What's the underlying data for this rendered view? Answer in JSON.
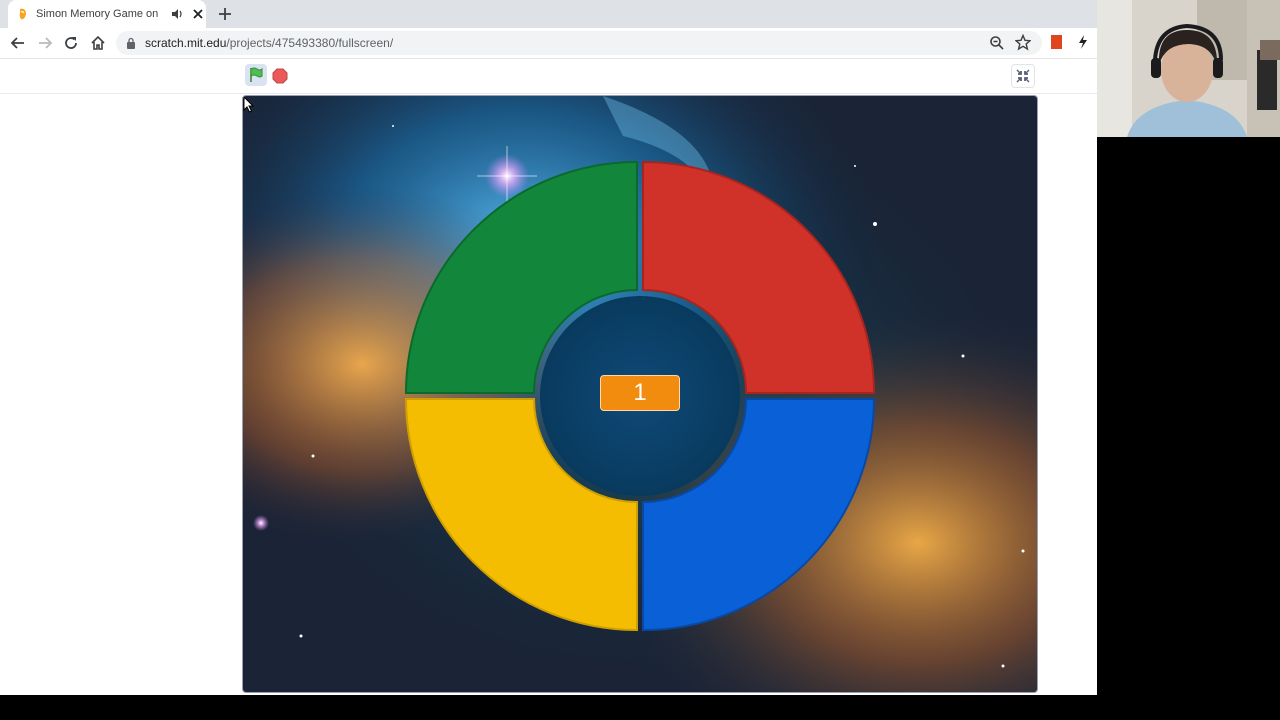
{
  "browser": {
    "tab": {
      "title": "Simon Memory Game on Scratch",
      "favicon": "scratch-cat-icon",
      "audio_icon": "speaker-icon",
      "close_icon": "close-icon"
    },
    "new_tab_icon": "plus-icon",
    "url_host": "scratch.mit.edu",
    "url_path": "/projects/475493380/fullscreen/"
  },
  "scratch": {
    "green_flag_icon": "green-flag-icon",
    "stop_icon": "stop-sign-icon",
    "exit_fullscreen_icon": "exit-fullscreen-icon"
  },
  "game": {
    "score": "1",
    "segments": [
      {
        "name": "green",
        "color": "#12873c"
      },
      {
        "name": "red",
        "color": "#d0322a"
      },
      {
        "name": "yellow",
        "color": "#f5bd02"
      },
      {
        "name": "blue",
        "color": "#0a60d6"
      }
    ],
    "score_box_color": "#f28c0f"
  }
}
